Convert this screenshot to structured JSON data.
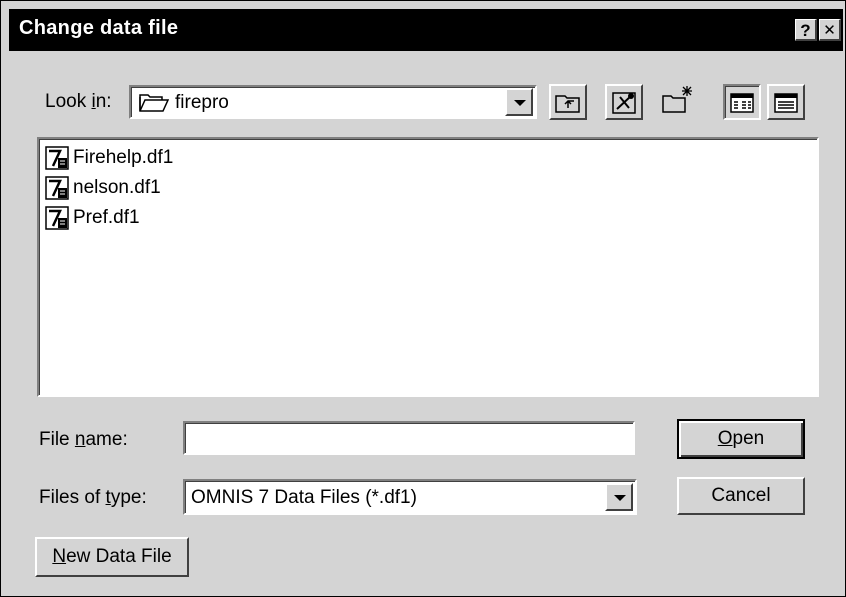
{
  "dialog": {
    "title": "Change data file",
    "help_glyph": "?",
    "close_glyph": "✕"
  },
  "look_in": {
    "label_pre": "Look ",
    "label_accel": "i",
    "label_post": "n:",
    "value": "firepro"
  },
  "toolbar": {
    "icons": [
      "up-one-level-icon",
      "desktop-icon",
      "create-new-folder-icon",
      "list-view-icon",
      "details-view-icon"
    ]
  },
  "files": [
    {
      "name": "Firehelp.df1",
      "icon": "omnis-data-file-icon"
    },
    {
      "name": "nelson.df1",
      "icon": "omnis-data-file-icon"
    },
    {
      "name": "Pref.df1",
      "icon": "omnis-data-file-icon"
    }
  ],
  "file_name": {
    "label_pre": "File ",
    "label_accel": "n",
    "label_post": "ame:",
    "value": ""
  },
  "files_of_type": {
    "label_pre": "Files of ",
    "label_accel": "t",
    "label_post": "ype:",
    "value": "OMNIS 7 Data Files (*.df1)"
  },
  "buttons": {
    "open_accel": "O",
    "open_rest": "pen",
    "cancel": "Cancel",
    "new_accel": "N",
    "new_rest": "ew Data File"
  }
}
